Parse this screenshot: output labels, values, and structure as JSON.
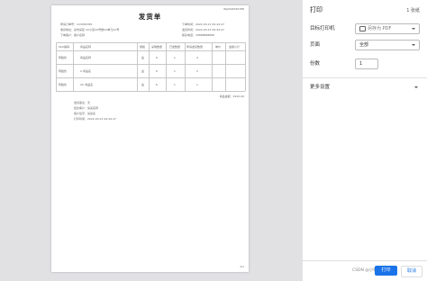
{
  "doc": {
    "top_code": "WJ2024050788",
    "title": "发货单",
    "info": {
      "order_no": "申请订单号：123456789",
      "date1": "下单时间：2022-03-21 09:44:47",
      "addr": "收货地址：某市某区 XX小区XX号楼XX单元XX号",
      "date2": "发货时间：2022-03-21 09:44:47",
      "receiver": "下单客户：客户名称",
      "phone": "联系电话：18888888888"
    },
    "table": {
      "headers": [
        "SKU编码",
        "商品名称",
        "规格",
        "采购数量",
        "已发数量",
        "申请发货数量",
        "单价",
        "金额小计"
      ],
      "rows": [
        [
          "阿胶饮",
          "商品名称",
          "盒",
          "6",
          "1",
          "4",
          "",
          ""
        ],
        [
          "阿胶饮",
          "X 商品名",
          "盒",
          "6",
          "1",
          "2",
          "",
          ""
        ],
        [
          "阿胶饮",
          "XX 商品名",
          "盒",
          "6",
          "1",
          "1",
          "",
          ""
        ]
      ]
    },
    "total": "商品金额：¥100.00",
    "footer": {
      "line1": "发货备注：无",
      "line2": "经办客户：某某名称",
      "line3": "客户签字：某某名",
      "line4": "打印时间：2022-03-21 09:44:47"
    },
    "page_label": "1/1"
  },
  "panel": {
    "title": "打印",
    "sheet_count": "1 张纸",
    "printer_label": "目标打印机",
    "printer_value": "另存为 PDF",
    "pages_label": "页面",
    "pages_value": "全部",
    "copies_label": "份数",
    "copies_value": "1",
    "more_settings": "更多设置",
    "print_button": "打印",
    "cancel_button": "取消",
    "watermark": "CSDN @小程序猿"
  }
}
